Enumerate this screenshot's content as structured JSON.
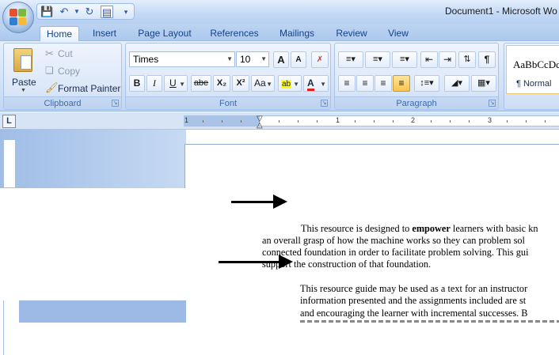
{
  "window": {
    "title": "Document1 - Microsoft Wo"
  },
  "tabs": [
    "Home",
    "Insert",
    "Page Layout",
    "References",
    "Mailings",
    "Review",
    "View"
  ],
  "clipboard": {
    "paste_label": "Paste",
    "cut_label": "Cut",
    "copy_label": "Copy",
    "format_painter_label": "Format Painter",
    "group_label": "Clipboard"
  },
  "font": {
    "family": "Times",
    "size": "10",
    "group_label": "Font",
    "grow_label": "A",
    "shrink_label": "A",
    "bold_label": "B",
    "italic_label": "I",
    "underline_label": "U",
    "strike_label": "abe",
    "subscript_label": "X₂",
    "superscript_label": "X²",
    "case_label": "Aa",
    "font_color_label": "A"
  },
  "paragraph": {
    "group_label": "Paragraph"
  },
  "styles": {
    "preview_text": "AaBbCcDd",
    "normal_label": "¶ Normal"
  },
  "ruler": {
    "tab_selector": "L",
    "numbers": [
      "1",
      "1",
      "2",
      "3"
    ]
  },
  "document": {
    "para1_line1_pre": "This resource is designed to ",
    "para1_line1_bold": "empower",
    "para1_line1_post": " learners with basic kn",
    "para1_line2": "an overall grasp of how the machine works so they can problem sol",
    "para1_line3": "connected foundation in order to facilitate problem solving. This gui",
    "para1_line4": "support the construction of that foundation.",
    "para2_line1": "This resource guide may be used as a text for an instructor",
    "para2_line2": "information presented and the assignments included are st",
    "para2_line3": "and encouraging the learner with incremental successes. B"
  }
}
